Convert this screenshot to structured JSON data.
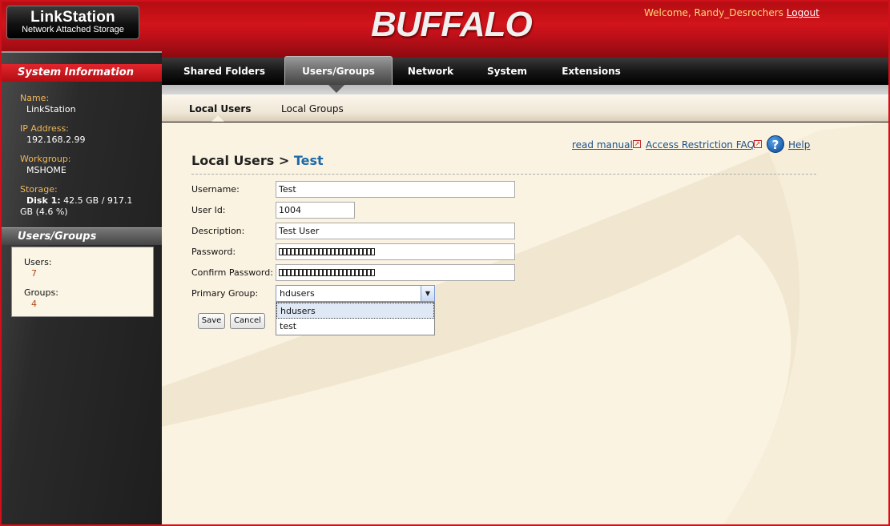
{
  "header": {
    "logo_title": "LinkStation",
    "logo_subtitle": "Network Attached Storage",
    "brand": "BUFFALO",
    "brand_tm": "™",
    "welcome_text": "Welcome, Randy_Desrochers",
    "logout_label": "Logout"
  },
  "nav": {
    "tabs": [
      {
        "label": "Shared Folders"
      },
      {
        "label": "Users/Groups"
      },
      {
        "label": "Network"
      },
      {
        "label": "System"
      },
      {
        "label": "Extensions"
      }
    ],
    "active": "Users/Groups"
  },
  "subnav": {
    "tabs": [
      {
        "label": "Local Users"
      },
      {
        "label": "Local Groups"
      }
    ],
    "active": "Local Users"
  },
  "sidebar": {
    "system_header": "System Information",
    "name_label": "Name:",
    "name_value": "LinkStation",
    "ip_label": "IP Address:",
    "ip_value": "192.168.2.99",
    "workgroup_label": "Workgroup:",
    "workgroup_value": "MSHOME",
    "storage_label": "Storage:",
    "storage_disk_label": "Disk 1:",
    "storage_disk_value": "42.5 GB / 917.1",
    "storage_disk_value2": "GB (4.6 %)",
    "ug_header": "Users/Groups",
    "users_label": "Users:",
    "users_value": "7",
    "groups_label": "Groups:",
    "groups_value": "4"
  },
  "content": {
    "links": {
      "read_manual": "read manual",
      "faq": "Access Restriction FAQ",
      "help": "Help"
    },
    "heading_prefix": "Local Users >",
    "heading_user": "Test",
    "form": {
      "username_label": "Username:",
      "username_value": "Test",
      "userid_label": "User Id:",
      "userid_value": "1004",
      "description_label": "Description:",
      "description_value": "Test User",
      "password_label": "Password:",
      "confirm_label": "Confirm Password:",
      "primary_group_label": "Primary Group:",
      "primary_group_value": "hdusers",
      "primary_group_options": [
        "hdusers",
        "test"
      ]
    },
    "save_label": "Save",
    "cancel_label": "Cancel"
  },
  "colors": {
    "brand_red": "#d2141b",
    "link_blue": "#1a4f8a",
    "sidebar_label": "#f0b65a",
    "content_bg": "#fbf3e1"
  }
}
